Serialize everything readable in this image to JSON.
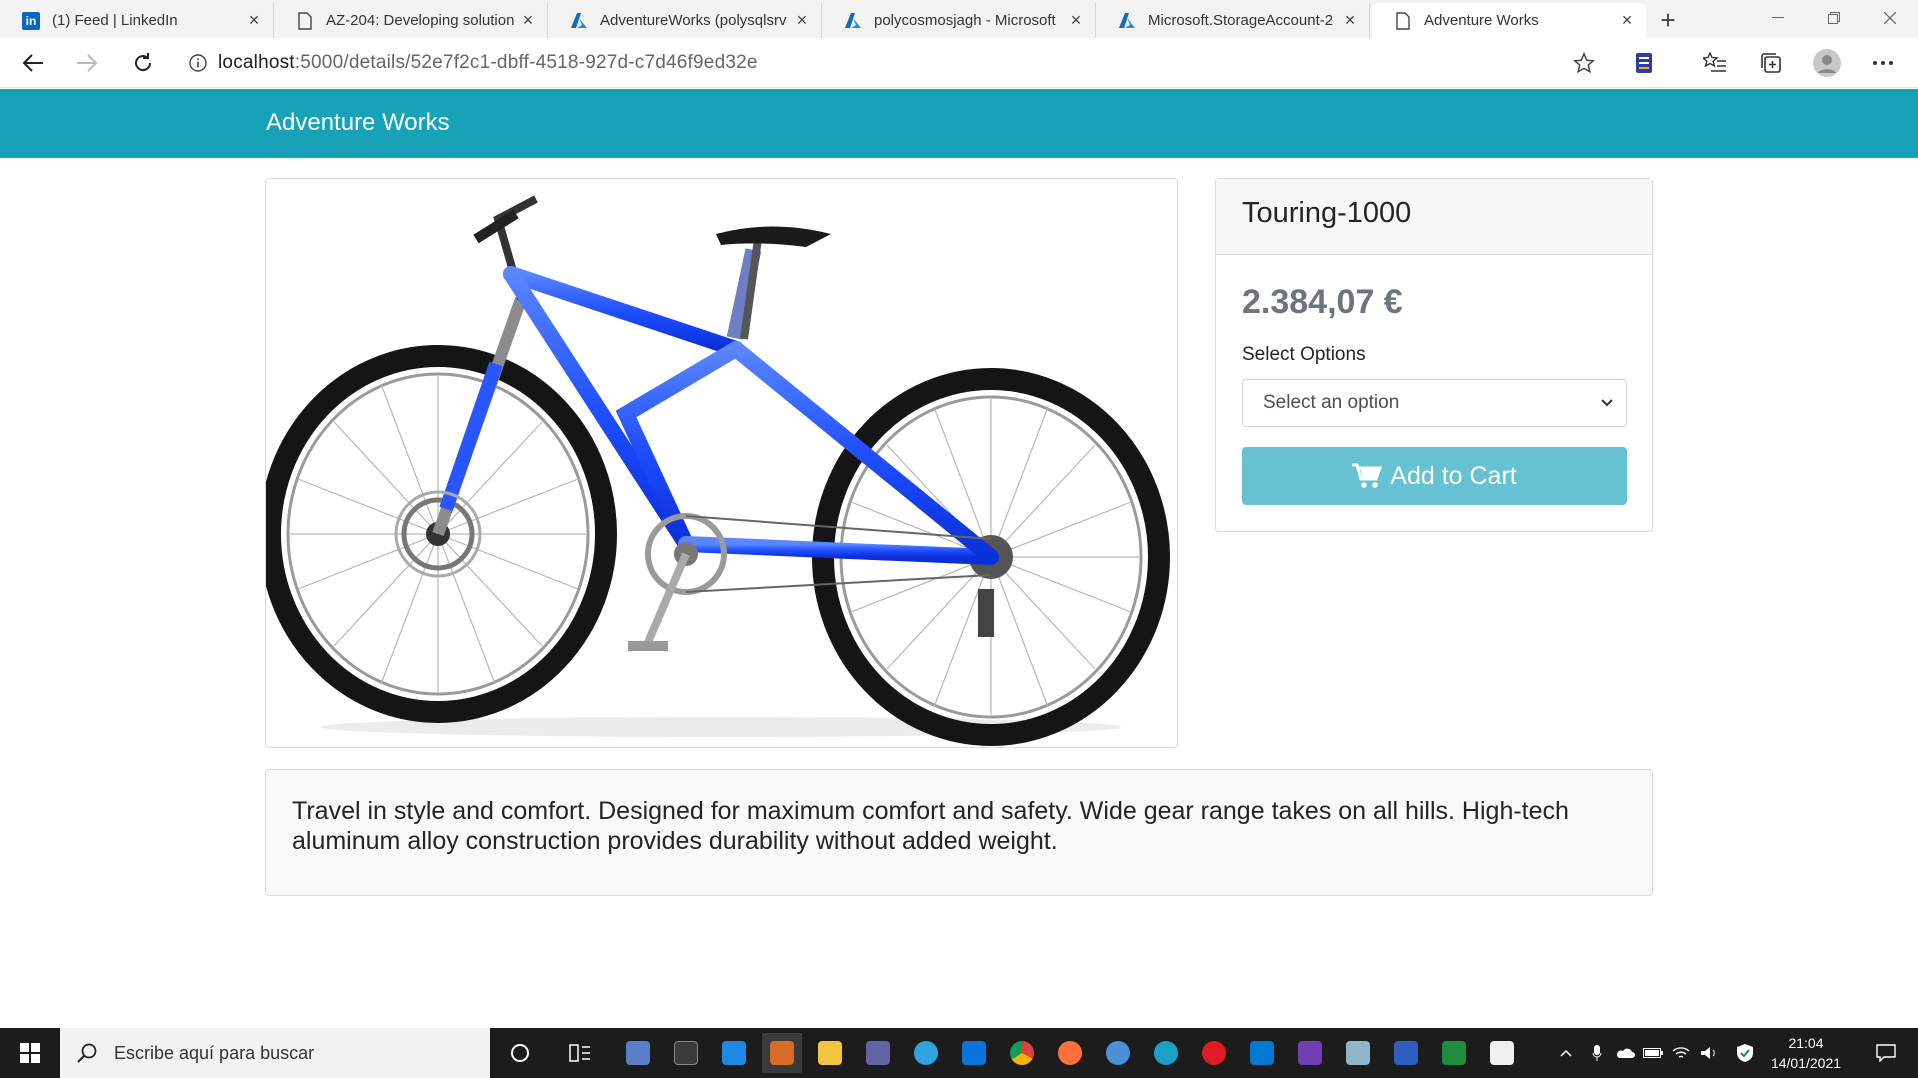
{
  "browser": {
    "tabs": [
      {
        "label": "(1) Feed | LinkedIn",
        "icon": "linkedin-icon"
      },
      {
        "label": "AZ-204: Developing solution",
        "icon": "page-icon"
      },
      {
        "label": "AdventureWorks (polysqlsrv",
        "icon": "azure-icon"
      },
      {
        "label": "polycosmosjagh - Microsoft",
        "icon": "azure-icon"
      },
      {
        "label": "Microsoft.StorageAccount-2",
        "icon": "azure-icon"
      },
      {
        "label": "Adventure Works",
        "icon": "page-icon",
        "active": true
      }
    ],
    "url_host": "localhost",
    "url_path": ":5000/details/52e7f2c1-dbff-4518-927d-c7d46f9ed32e"
  },
  "site": {
    "brand": "Adventure Works",
    "navbar_color": "#17a2b8"
  },
  "product": {
    "name": "Touring-1000",
    "price": "2.384,07 €",
    "options_label": "Select Options",
    "select_placeholder": "Select an option",
    "add_to_cart": "Add to Cart",
    "description": "Travel in style and comfort. Designed for maximum comfort and safety. Wide gear range takes on all hills. High-tech aluminum alloy construction provides durability without added weight.",
    "frame_color": "#1f4fff"
  },
  "taskbar": {
    "search_placeholder": "Escribe aquí para buscar",
    "time": "21:04",
    "date": "14/01/2021"
  }
}
